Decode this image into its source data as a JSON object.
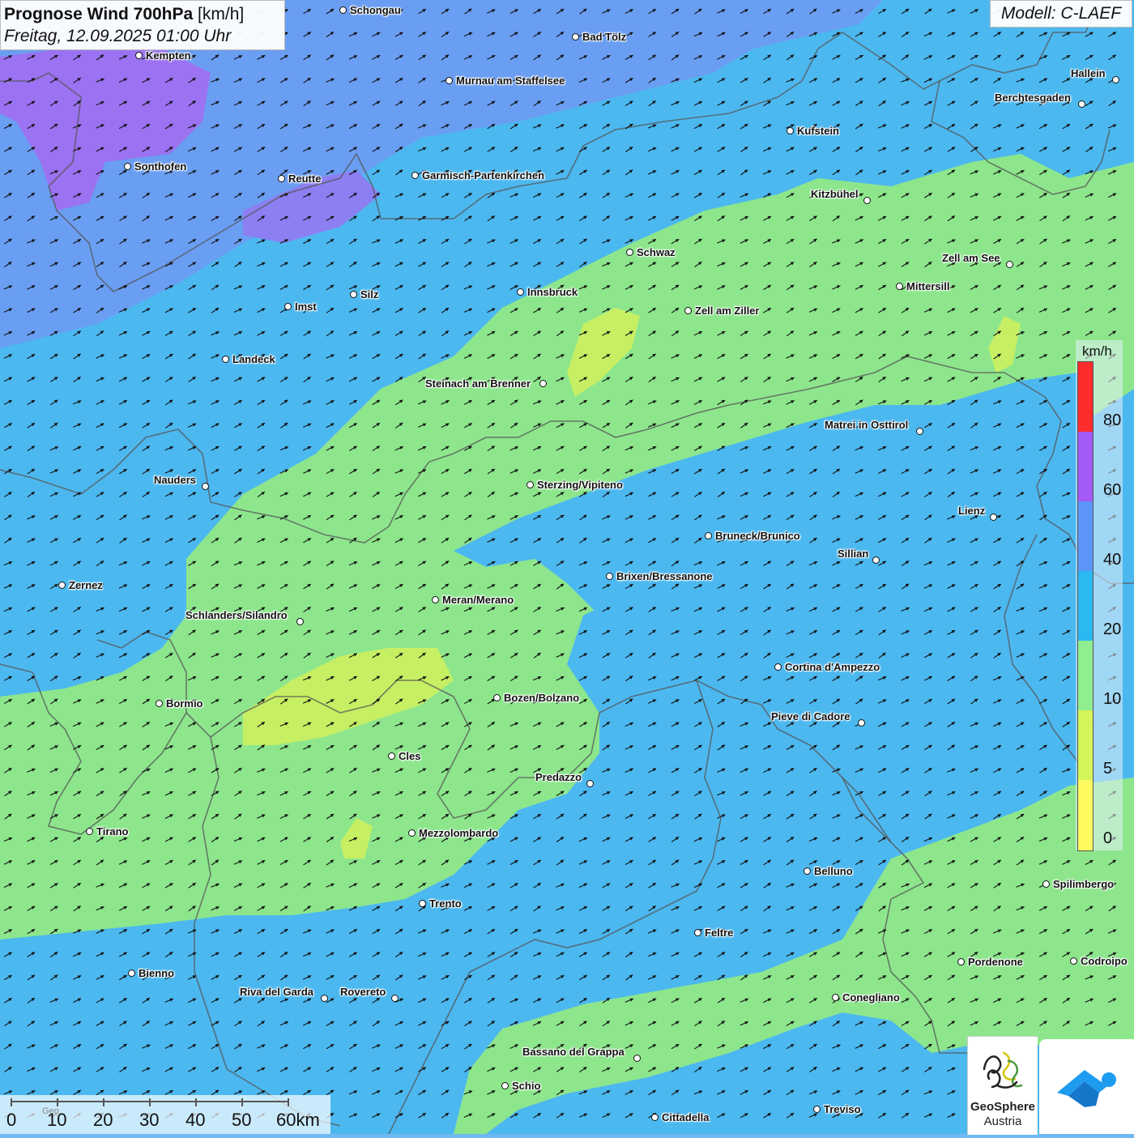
{
  "title": {
    "main": "Prognose Wind 700hPa",
    "unit": "[km/h]",
    "datetime": "Freitag, 12.09.2025 01:00 Uhr"
  },
  "model_label": "Modell: C-LAEF",
  "legend": {
    "unit": "km/h",
    "labels": [
      "80",
      "60",
      "40",
      "20",
      "10",
      "5",
      "0"
    ],
    "colors": [
      "#ff2c2c",
      "#a45af5",
      "#5b95f7",
      "#2bb9f1",
      "#8fee8f",
      "#d3f559",
      "#fcfa5e"
    ]
  },
  "scale": {
    "ticks": [
      "0",
      "10",
      "20",
      "30",
      "40",
      "50",
      "60km"
    ],
    "watermark": "Geo.."
  },
  "colors": {
    "wind_0_5": "#fcfa5e",
    "wind_5_10": "#d3f559",
    "wind_10_20": "#8fee8f",
    "wind_20_40": "#2bb9f1",
    "wind_40_60": "#5b95f7",
    "wind_60_80": "#a45af5",
    "border": "#555555"
  },
  "logos": {
    "geosphere_line1": "GeoSphere",
    "geosphere_line2": "Austria",
    "app_icon": "weather-app-icon"
  },
  "cities": [
    {
      "name": "Schongau"
    },
    {
      "name": "Bad Tölz"
    },
    {
      "name": "Kempten"
    },
    {
      "name": "Murnau am Staffelsee"
    },
    {
      "name": "Hallein"
    },
    {
      "name": "Berchtesgaden"
    },
    {
      "name": "Kufstein"
    },
    {
      "name": "Sonthofen"
    },
    {
      "name": "Reutte"
    },
    {
      "name": "Garmisch-Partenkirchen"
    },
    {
      "name": "Kitzbühel"
    },
    {
      "name": "Schwaz"
    },
    {
      "name": "Zell am See"
    },
    {
      "name": "Mittersill"
    },
    {
      "name": "Innsbruck"
    },
    {
      "name": "Imst"
    },
    {
      "name": "Silz"
    },
    {
      "name": "Zell am Ziller"
    },
    {
      "name": "Landeck"
    },
    {
      "name": "Steinach am Brenner"
    },
    {
      "name": "Matrei in Osttirol"
    },
    {
      "name": "Nauders"
    },
    {
      "name": "Sterzing/Vipiteno"
    },
    {
      "name": "Lienz"
    },
    {
      "name": "Bruneck/Brunico"
    },
    {
      "name": "Sillian"
    },
    {
      "name": "Zernez"
    },
    {
      "name": "Brixen/Bressanone"
    },
    {
      "name": "Meran/Merano"
    },
    {
      "name": "Schlanders/Silandro"
    },
    {
      "name": "Cortina d'Ampezzo"
    },
    {
      "name": "Bormio"
    },
    {
      "name": "Bozen/Bolzano"
    },
    {
      "name": "Pieve di Cadore"
    },
    {
      "name": "Cles"
    },
    {
      "name": "Predazzo"
    },
    {
      "name": "Tirano"
    },
    {
      "name": "Mezzolombardo"
    },
    {
      "name": "Belluno"
    },
    {
      "name": "Spilimbergo"
    },
    {
      "name": "Trento"
    },
    {
      "name": "Feltre"
    },
    {
      "name": "Pordenone"
    },
    {
      "name": "Codroipo"
    },
    {
      "name": "Bienno"
    },
    {
      "name": "Riva del Garda"
    },
    {
      "name": "Rovereto"
    },
    {
      "name": "Conegliano"
    },
    {
      "name": "Bassano del Grappa"
    },
    {
      "name": "Schio"
    },
    {
      "name": "Cittadella"
    },
    {
      "name": "Treviso"
    }
  ]
}
